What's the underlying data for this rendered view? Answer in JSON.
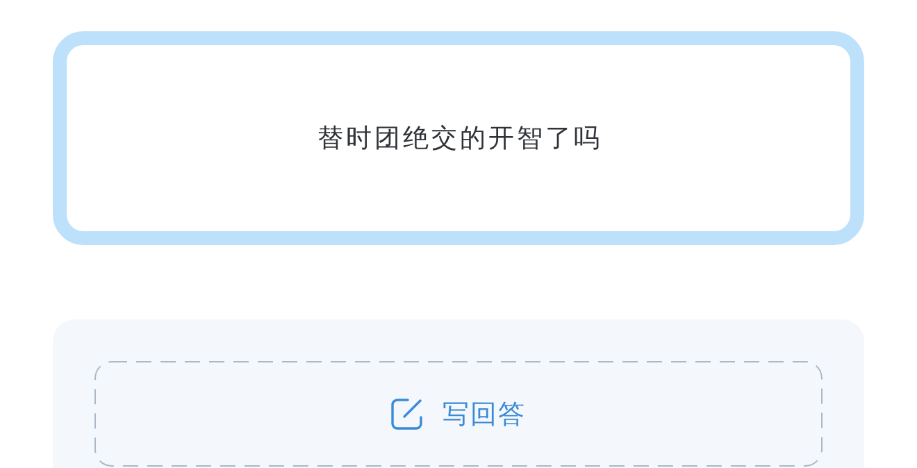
{
  "question": {
    "text": "替时团绝交的开智了吗"
  },
  "answer_button": {
    "label": "写回答"
  }
}
